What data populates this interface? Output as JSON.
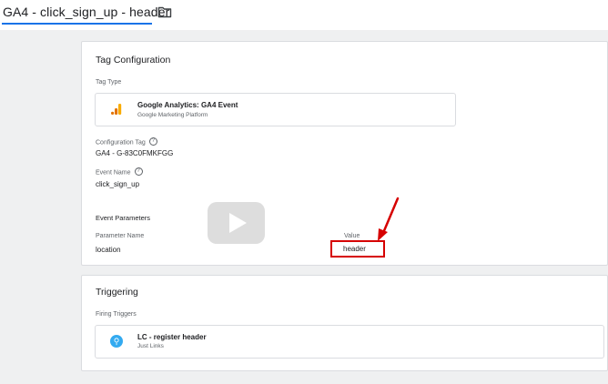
{
  "header": {
    "title": "GA4 - click_sign_up - header"
  },
  "tag_configuration": {
    "card_title": "Tag Configuration",
    "tag_type_label": "Tag Type",
    "tag_type_name": "Google Analytics: GA4 Event",
    "tag_type_vendor": "Google Marketing Platform",
    "config_tag_label": "Configuration Tag",
    "config_tag_value": "GA4 - G-83C0FMKFGG",
    "event_name_label": "Event Name",
    "event_name_value": "click_sign_up",
    "event_params_label": "Event Parameters",
    "param_name_header": "Parameter Name",
    "param_value_header": "Value",
    "rows": [
      {
        "name": "location",
        "value": "header"
      }
    ]
  },
  "triggering": {
    "card_title": "Triggering",
    "firing_label": "Firing Triggers",
    "trigger_name": "LC - register header",
    "trigger_type": "Just Links"
  },
  "colors": {
    "accent": "#1a73e8",
    "annotation": "#d60000",
    "ga_orange": "#f9ab00",
    "ga_dark_orange": "#e37400",
    "link_blue": "#33aaf0"
  },
  "icons": [
    "folder-icon",
    "google-analytics-icon",
    "help-icon",
    "play-icon",
    "link-icon",
    "annotation-arrow"
  ]
}
